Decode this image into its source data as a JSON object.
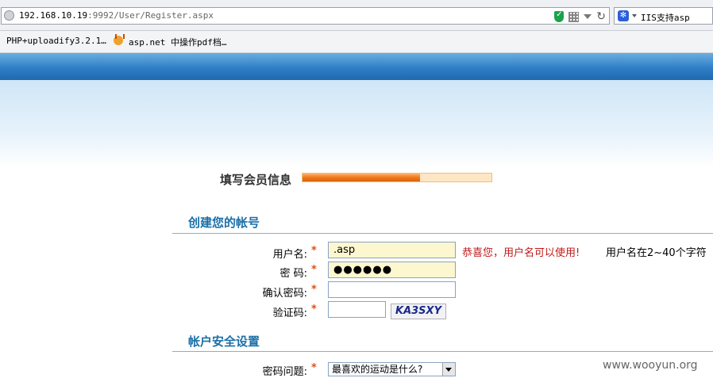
{
  "browser": {
    "url_host": "192.168.10.19",
    "url_rest": ":9992/User/Register.aspx",
    "search_text": "IIS支持asp",
    "bookmarks": [
      "PHP+uploadify3.2.1…",
      "asp.net 中操作pdf档…"
    ]
  },
  "form": {
    "step_title": "填写会员信息",
    "progress_percent": 62,
    "section_account": "创建您的帐号",
    "section_security": "帐户安全设置",
    "required_mark": "*",
    "fields": {
      "username": {
        "label": "用户名:",
        "value": ".asp",
        "ok_message": "恭喜您，用户名可以使用!",
        "hint": "用户名在2~40个字符"
      },
      "password": {
        "label": "密  码:",
        "masked_value": "●●●●●●"
      },
      "confirm_password": {
        "label": "确认密码:",
        "value": ""
      },
      "captcha": {
        "label": "验证码:",
        "value": "",
        "image_text": "KA3SXY"
      },
      "security_question": {
        "label": "密码问题:",
        "selected": "最喜欢的运动是什么?"
      }
    }
  },
  "watermark": "www.wooyun.org"
}
